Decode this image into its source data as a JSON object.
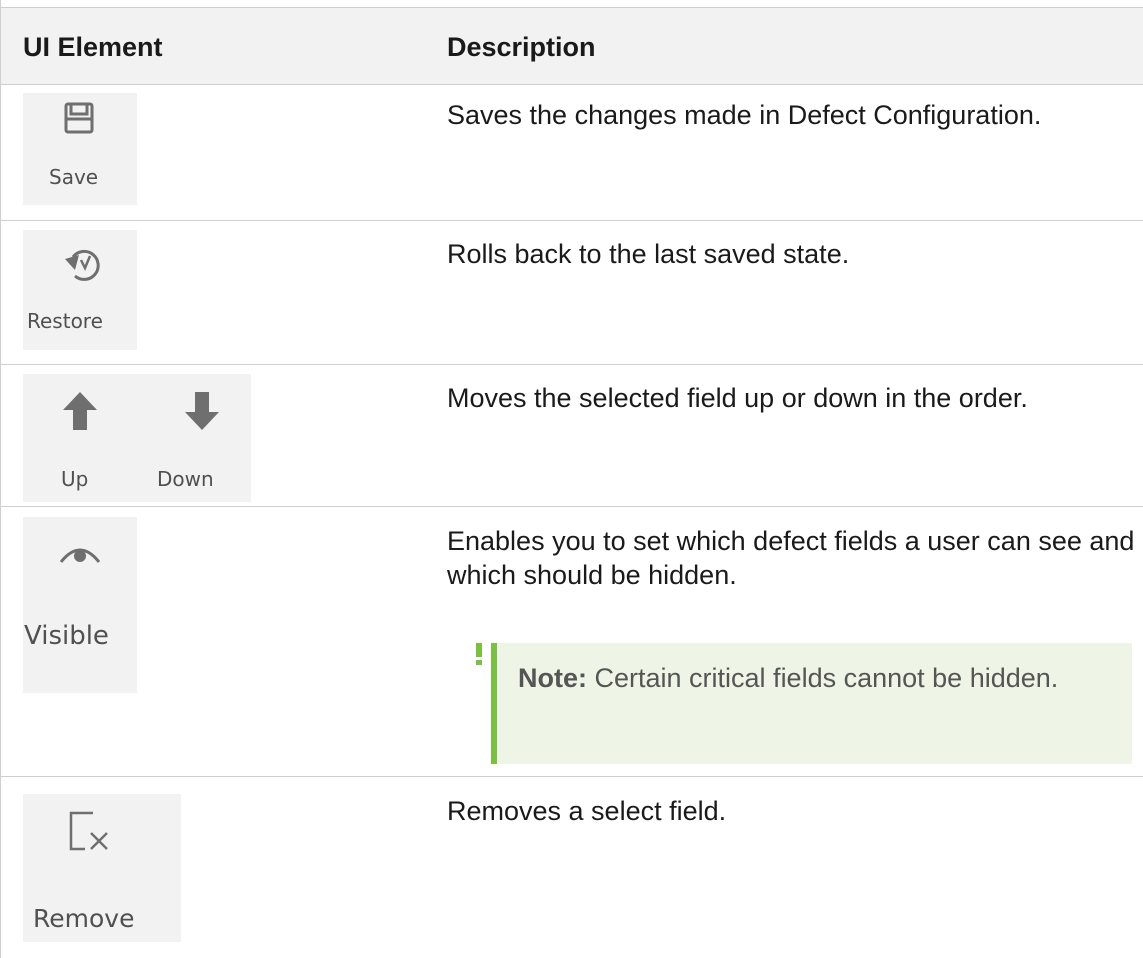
{
  "table": {
    "headers": {
      "ui_element": "UI Element",
      "description": "Description"
    },
    "rows": [
      {
        "buttons": [
          {
            "label": "Save",
            "icon": "save-icon"
          }
        ],
        "description": "Saves the changes made in Defect Configuration."
      },
      {
        "buttons": [
          {
            "label": "Restore",
            "icon": "restore-icon"
          }
        ],
        "description": "Rolls back to the last saved state."
      },
      {
        "buttons": [
          {
            "label": "Up",
            "icon": "arrow-up-icon"
          },
          {
            "label": "Down",
            "icon": "arrow-down-icon"
          }
        ],
        "description": "Moves the selected field up or down in the order."
      },
      {
        "buttons": [
          {
            "label": "Visible",
            "icon": "eye-icon"
          }
        ],
        "description": "Enables you to set which defect fields a user can see and which should be hidden.",
        "note": {
          "label": "Note:",
          "text": "Certain critical fields cannot be hidden."
        }
      },
      {
        "buttons": [
          {
            "label": "Remove",
            "icon": "remove-icon"
          }
        ],
        "description": "Removes a select field."
      }
    ]
  },
  "colors": {
    "note_accent": "#7ac143",
    "note_background": "#eef4e6",
    "button_background": "#f2f2f2",
    "icon_gray": "#6f6f6f"
  }
}
